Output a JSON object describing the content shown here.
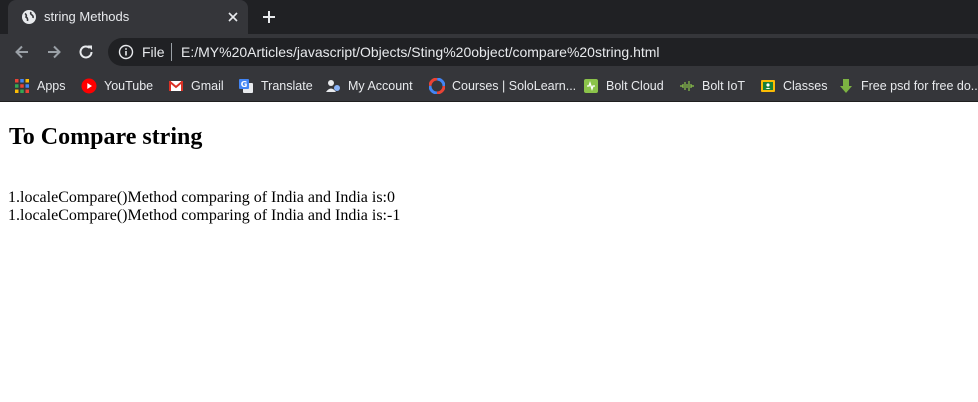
{
  "browser": {
    "tab": {
      "title": "string Methods",
      "favicon": "globe-icon"
    },
    "address_bar": {
      "scheme_label": "File",
      "url": "E:/MY%20Articles/javascript/Objects/Sting%20object/compare%20string.html"
    },
    "bookmarks": [
      {
        "label": "Apps",
        "icon": "apps-grid-icon"
      },
      {
        "label": "YouTube",
        "icon": "youtube-icon"
      },
      {
        "label": "Gmail",
        "icon": "gmail-icon"
      },
      {
        "label": "Translate",
        "icon": "translate-icon"
      },
      {
        "label": "My Account",
        "icon": "my-account-icon"
      },
      {
        "label": "Courses | SoloLearn...",
        "icon": "sololearn-icon"
      },
      {
        "label": "Bolt Cloud",
        "icon": "bolt-cloud-icon"
      },
      {
        "label": "Bolt IoT",
        "icon": "bolt-iot-icon"
      },
      {
        "label": "Classes",
        "icon": "classes-icon"
      },
      {
        "label": "Free psd for free do...",
        "icon": "download-arrow-icon"
      }
    ]
  },
  "page": {
    "heading": "To Compare string",
    "lines": [
      "1.localeCompare()Method comparing of India and India is:0",
      "1.localeCompare()Method comparing of India and India is:-1"
    ]
  },
  "colors": {
    "tabstrip_bg": "#202124",
    "toolbar_bg": "#35363a",
    "chrome_text": "#e8eaed",
    "page_bg": "#ffffff"
  }
}
